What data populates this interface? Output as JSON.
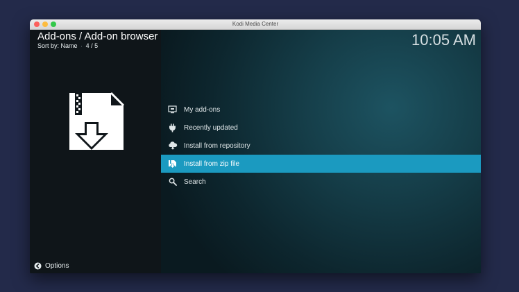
{
  "window": {
    "title": "Kodi Media Center"
  },
  "header": {
    "title": "Add-ons / Add-on browser",
    "sort_label": "Sort by: Name",
    "separator": "·",
    "position": "4 / 5",
    "clock": "10:05 AM"
  },
  "menu": {
    "selected_index": 3,
    "items": [
      {
        "label": "My add-ons",
        "icon": "monitor-icon"
      },
      {
        "label": "Recently updated",
        "icon": "plug-icon"
      },
      {
        "label": "Install from repository",
        "icon": "cloud-download-icon"
      },
      {
        "label": "Install from zip file",
        "icon": "zip-install-icon"
      },
      {
        "label": "Search",
        "icon": "search-icon"
      }
    ]
  },
  "footer": {
    "options_label": "Options"
  },
  "colors": {
    "desktop_background": "#232a4a",
    "selection_highlight": "#1b9ac0",
    "side_panel": "#0f1519"
  }
}
